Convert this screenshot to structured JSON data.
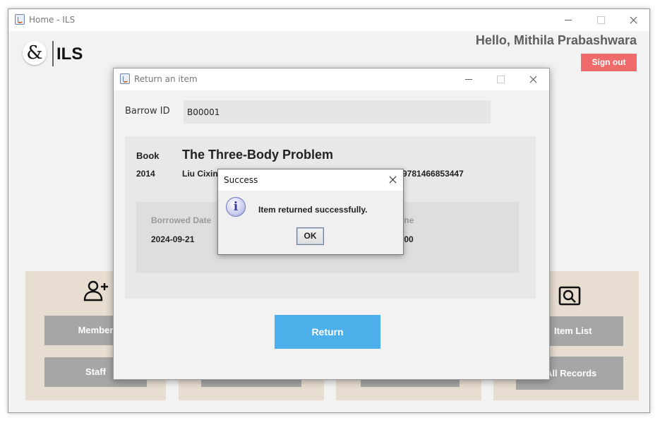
{
  "main_window": {
    "title": "Home - ILS",
    "logo_symbol": "&",
    "logo_text": "ILS",
    "greeting": "Hello, Mithila Prabashwara",
    "sign_out_label": "Sign out",
    "panels": [
      {
        "buttons": [
          "Member",
          "Staff"
        ],
        "icon": "add-person-icon"
      },
      {
        "buttons": []
      },
      {
        "buttons": []
      },
      {
        "buttons": [
          "Item List",
          "All Records"
        ],
        "icon": "search-window-icon"
      }
    ]
  },
  "return_dialog": {
    "title": "Return an item",
    "barrow_id_label": "Barrow ID",
    "barrow_id_value": "B00001",
    "book_label": "Book",
    "book_title": "The Three-Body Problem",
    "year": "2014",
    "author": "Liu Cixin",
    "isbn": "9781466853447",
    "borrowed_date_label": "Borrowed Date",
    "borrowed_date_value": "2024-09-21",
    "fine_label": "ine",
    "fine_value": ".00",
    "return_label": "Return"
  },
  "success_dialog": {
    "title": "Success",
    "message": "Item returned successfully.",
    "ok_label": "OK"
  },
  "colors": {
    "sign_out": "#ef6b6b",
    "return_button": "#4dafea",
    "panel_bg": "#e7ddd1",
    "grey_button": "#a6a6a6"
  }
}
